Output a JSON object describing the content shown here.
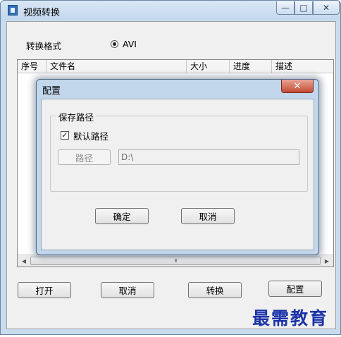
{
  "window": {
    "title": "视频转换",
    "icon": "app-icon",
    "controls": {
      "minimize": "—",
      "maximize": "□",
      "close": "✕"
    }
  },
  "format": {
    "label": "转换格式",
    "option": "AVI",
    "selected": true
  },
  "list": {
    "columns": [
      "序号",
      "文件名",
      "大小",
      "进度",
      "描述"
    ],
    "rows": [],
    "scrollbar_grip": "III"
  },
  "buttons": {
    "open": "打开",
    "cancel": "取消",
    "convert": "转换",
    "config": "配置"
  },
  "dialog": {
    "title": "配置",
    "close": "✕",
    "group_title": "保存路径",
    "default_path_label": "默认路径",
    "default_path_checked": true,
    "path_button": "路径",
    "path_value": "D:\\",
    "ok": "确定",
    "cancel": "取消"
  },
  "watermark": "最需教育",
  "colors": {
    "frame": "#c9dcee",
    "client": "#f0f0f0",
    "dialog_close": "#c24a34",
    "watermark": "#1c33a8"
  }
}
